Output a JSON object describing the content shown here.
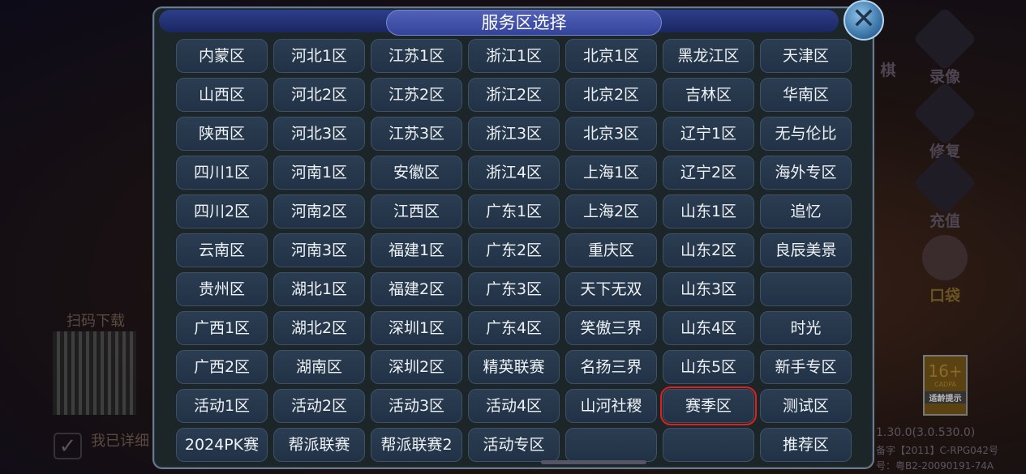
{
  "dialog": {
    "title": "服务区选择",
    "close_icon": "close-x-icon"
  },
  "servers": [
    [
      "内蒙区",
      "河北1区",
      "江苏1区",
      "浙江1区",
      "北京1区",
      "黑龙江区",
      "天津区"
    ],
    [
      "山西区",
      "河北2区",
      "江苏2区",
      "浙江2区",
      "北京2区",
      "吉林区",
      "华南区"
    ],
    [
      "陕西区",
      "河北3区",
      "江苏3区",
      "浙江3区",
      "北京3区",
      "辽宁1区",
      "无与伦比"
    ],
    [
      "四川1区",
      "河南1区",
      "安徽区",
      "浙江4区",
      "上海1区",
      "辽宁2区",
      "海外专区"
    ],
    [
      "四川2区",
      "河南2区",
      "江西区",
      "广东1区",
      "上海2区",
      "山东1区",
      "追忆"
    ],
    [
      "云南区",
      "河南3区",
      "福建1区",
      "广东2区",
      "重庆区",
      "山东2区",
      "良辰美景"
    ],
    [
      "贵州区",
      "湖北1区",
      "福建2区",
      "广东3区",
      "天下无双",
      "山东3区",
      ""
    ],
    [
      "广西1区",
      "湖北2区",
      "深圳1区",
      "广东4区",
      "笑傲三界",
      "山东4区",
      "时光"
    ],
    [
      "广西2区",
      "湖南区",
      "深圳2区",
      "精英联赛",
      "名扬三界",
      "山东5区",
      "新手专区"
    ],
    [
      "活动1区",
      "活动2区",
      "活动3区",
      "活动4区",
      "山河社稷",
      "赛季区",
      "测试区"
    ],
    [
      "2024PK赛",
      "帮派联赛",
      "帮派联赛2",
      "活动专区",
      "",
      "",
      "推荐区"
    ]
  ],
  "selected": "赛季区",
  "selected_color": "#e0201e",
  "background": {
    "qr_label": "扫码下载",
    "agree_text": "我已详细",
    "side_menu": [
      "棋",
      "录像",
      "修复",
      "充值",
      "口袋"
    ],
    "age_rating": {
      "value": "16+",
      "org": "CADPA",
      "label": "适龄提示"
    },
    "version": "1.30.0(3.0.530.0)",
    "license1": "备字【2011】C-RPG042号",
    "license2": "号：粤B2-20090191-74A"
  }
}
